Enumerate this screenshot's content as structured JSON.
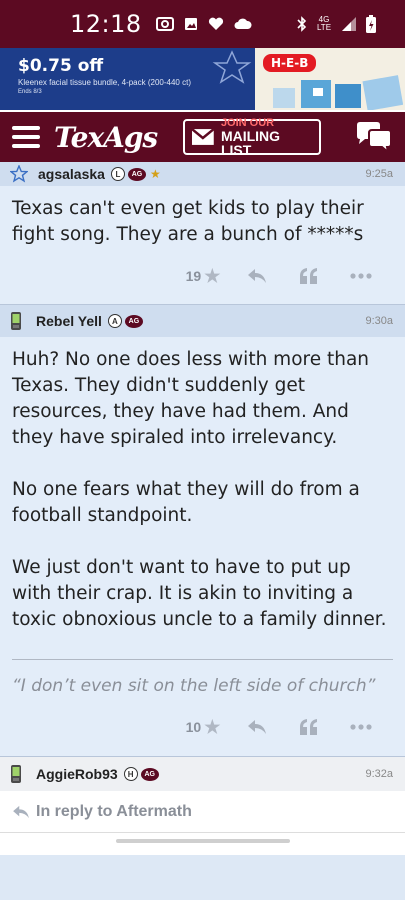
{
  "status": {
    "time": "12:18",
    "network": "4G LTE"
  },
  "ad": {
    "price": "$0.75 off",
    "description": "Kleenex facial tissue bundle, 4-pack (200-440 ct)",
    "ends": "Ends 8/3",
    "brand": "H-E-B"
  },
  "nav": {
    "logo": "TexAgs",
    "mailing_line1": "JOIN OUR",
    "mailing_line2": "MAILING LIST"
  },
  "posts": [
    {
      "user": "agsalaska",
      "badge": "L",
      "ag": "AG",
      "time": "9:25a",
      "body": [
        "Texas can't even get kids to play their fight song. They are a bunch of *****s"
      ],
      "votes": "19"
    },
    {
      "user": "Rebel Yell",
      "badge": "A",
      "ag": "AG",
      "time": "9:30a",
      "body": [
        "Huh? No one does less with more than Texas. They didn't suddenly get resources, they have had them. And they have spiraled into irrelevancy.",
        "No one fears what they will do from a football standpoint.",
        "We just don't want to have to put up with their crap. It is akin to inviting a toxic obnoxious uncle to a family dinner."
      ],
      "signature": "“I don’t even sit on the left side of church”",
      "votes": "10"
    },
    {
      "user": "AggieRob93",
      "badge": "H",
      "ag": "AG",
      "time": "9:32a"
    }
  ],
  "reply": {
    "label": "In reply to Aftermath"
  },
  "colors": {
    "maroon": "#5c0a22",
    "header_blue": "#cfddef",
    "body_blue": "#e3edf9"
  }
}
